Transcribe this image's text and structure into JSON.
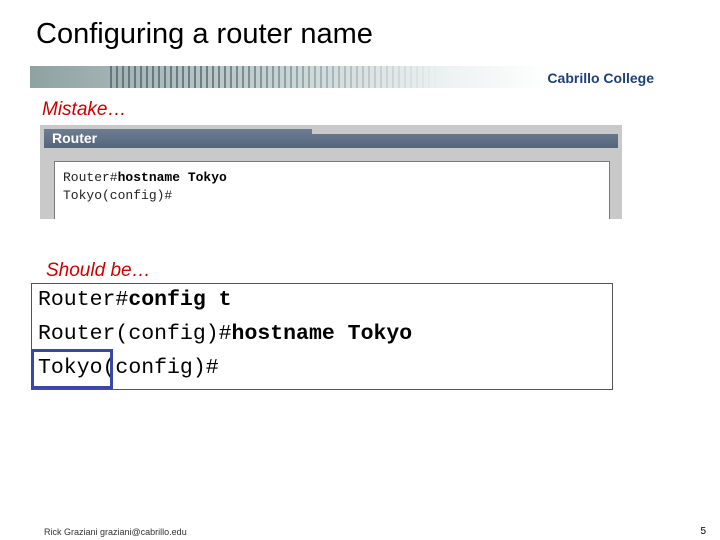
{
  "slide": {
    "title": "Configuring a router name",
    "brand": "Cabrillo College",
    "mistake_label": "Mistake…",
    "should_label": "Should be…",
    "page_number": "5",
    "footer": "Rick Graziani graziani@cabrillo.edu"
  },
  "router_window": {
    "title": "Router",
    "line1_prompt": "Router#",
    "line1_cmd": "hostname Tokyo",
    "line2": "Tokyo(config)#"
  },
  "correct_commands": {
    "line1_prompt": "Router#",
    "line1_cmd": "config t",
    "line2_prompt": "Router(config)#",
    "line2_cmd": "hostname Tokyo",
    "line3_name": "Tokyo",
    "line3_rest": "(config)#"
  },
  "colors": {
    "label_red": "#cc0000",
    "highlight_blue": "#3848a8",
    "brand_blue": "#1d3f7a"
  }
}
